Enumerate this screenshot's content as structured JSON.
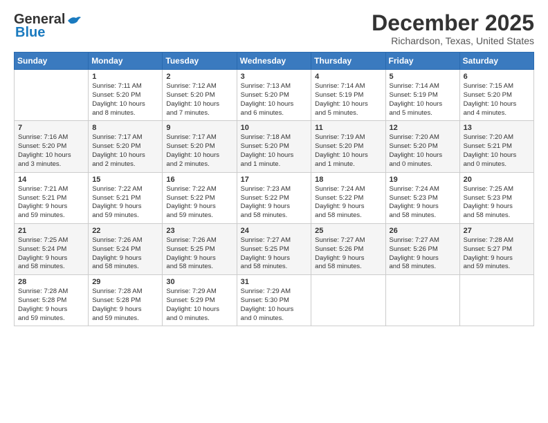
{
  "header": {
    "logo_general": "General",
    "logo_blue": "Blue",
    "month": "December 2025",
    "location": "Richardson, Texas, United States"
  },
  "days_of_week": [
    "Sunday",
    "Monday",
    "Tuesday",
    "Wednesday",
    "Thursday",
    "Friday",
    "Saturday"
  ],
  "weeks": [
    [
      {
        "day": "",
        "info": ""
      },
      {
        "day": "1",
        "info": "Sunrise: 7:11 AM\nSunset: 5:20 PM\nDaylight: 10 hours\nand 8 minutes."
      },
      {
        "day": "2",
        "info": "Sunrise: 7:12 AM\nSunset: 5:20 PM\nDaylight: 10 hours\nand 7 minutes."
      },
      {
        "day": "3",
        "info": "Sunrise: 7:13 AM\nSunset: 5:20 PM\nDaylight: 10 hours\nand 6 minutes."
      },
      {
        "day": "4",
        "info": "Sunrise: 7:14 AM\nSunset: 5:19 PM\nDaylight: 10 hours\nand 5 minutes."
      },
      {
        "day": "5",
        "info": "Sunrise: 7:14 AM\nSunset: 5:19 PM\nDaylight: 10 hours\nand 5 minutes."
      },
      {
        "day": "6",
        "info": "Sunrise: 7:15 AM\nSunset: 5:20 PM\nDaylight: 10 hours\nand 4 minutes."
      }
    ],
    [
      {
        "day": "7",
        "info": "Sunrise: 7:16 AM\nSunset: 5:20 PM\nDaylight: 10 hours\nand 3 minutes."
      },
      {
        "day": "8",
        "info": "Sunrise: 7:17 AM\nSunset: 5:20 PM\nDaylight: 10 hours\nand 2 minutes."
      },
      {
        "day": "9",
        "info": "Sunrise: 7:17 AM\nSunset: 5:20 PM\nDaylight: 10 hours\nand 2 minutes."
      },
      {
        "day": "10",
        "info": "Sunrise: 7:18 AM\nSunset: 5:20 PM\nDaylight: 10 hours\nand 1 minute."
      },
      {
        "day": "11",
        "info": "Sunrise: 7:19 AM\nSunset: 5:20 PM\nDaylight: 10 hours\nand 1 minute."
      },
      {
        "day": "12",
        "info": "Sunrise: 7:20 AM\nSunset: 5:20 PM\nDaylight: 10 hours\nand 0 minutes."
      },
      {
        "day": "13",
        "info": "Sunrise: 7:20 AM\nSunset: 5:21 PM\nDaylight: 10 hours\nand 0 minutes."
      }
    ],
    [
      {
        "day": "14",
        "info": "Sunrise: 7:21 AM\nSunset: 5:21 PM\nDaylight: 9 hours\nand 59 minutes."
      },
      {
        "day": "15",
        "info": "Sunrise: 7:22 AM\nSunset: 5:21 PM\nDaylight: 9 hours\nand 59 minutes."
      },
      {
        "day": "16",
        "info": "Sunrise: 7:22 AM\nSunset: 5:22 PM\nDaylight: 9 hours\nand 59 minutes."
      },
      {
        "day": "17",
        "info": "Sunrise: 7:23 AM\nSunset: 5:22 PM\nDaylight: 9 hours\nand 58 minutes."
      },
      {
        "day": "18",
        "info": "Sunrise: 7:24 AM\nSunset: 5:22 PM\nDaylight: 9 hours\nand 58 minutes."
      },
      {
        "day": "19",
        "info": "Sunrise: 7:24 AM\nSunset: 5:23 PM\nDaylight: 9 hours\nand 58 minutes."
      },
      {
        "day": "20",
        "info": "Sunrise: 7:25 AM\nSunset: 5:23 PM\nDaylight: 9 hours\nand 58 minutes."
      }
    ],
    [
      {
        "day": "21",
        "info": "Sunrise: 7:25 AM\nSunset: 5:24 PM\nDaylight: 9 hours\nand 58 minutes."
      },
      {
        "day": "22",
        "info": "Sunrise: 7:26 AM\nSunset: 5:24 PM\nDaylight: 9 hours\nand 58 minutes."
      },
      {
        "day": "23",
        "info": "Sunrise: 7:26 AM\nSunset: 5:25 PM\nDaylight: 9 hours\nand 58 minutes."
      },
      {
        "day": "24",
        "info": "Sunrise: 7:27 AM\nSunset: 5:25 PM\nDaylight: 9 hours\nand 58 minutes."
      },
      {
        "day": "25",
        "info": "Sunrise: 7:27 AM\nSunset: 5:26 PM\nDaylight: 9 hours\nand 58 minutes."
      },
      {
        "day": "26",
        "info": "Sunrise: 7:27 AM\nSunset: 5:26 PM\nDaylight: 9 hours\nand 58 minutes."
      },
      {
        "day": "27",
        "info": "Sunrise: 7:28 AM\nSunset: 5:27 PM\nDaylight: 9 hours\nand 59 minutes."
      }
    ],
    [
      {
        "day": "28",
        "info": "Sunrise: 7:28 AM\nSunset: 5:28 PM\nDaylight: 9 hours\nand 59 minutes."
      },
      {
        "day": "29",
        "info": "Sunrise: 7:28 AM\nSunset: 5:28 PM\nDaylight: 9 hours\nand 59 minutes."
      },
      {
        "day": "30",
        "info": "Sunrise: 7:29 AM\nSunset: 5:29 PM\nDaylight: 10 hours\nand 0 minutes."
      },
      {
        "day": "31",
        "info": "Sunrise: 7:29 AM\nSunset: 5:30 PM\nDaylight: 10 hours\nand 0 minutes."
      },
      {
        "day": "",
        "info": ""
      },
      {
        "day": "",
        "info": ""
      },
      {
        "day": "",
        "info": ""
      }
    ]
  ]
}
